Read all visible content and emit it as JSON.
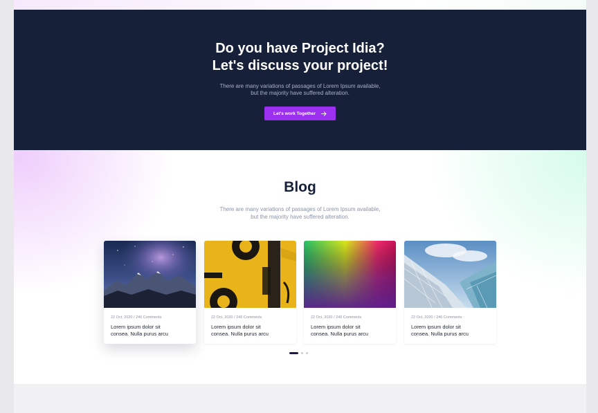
{
  "cta": {
    "title_line1": "Do you have Project Idia?",
    "title_line2": "Let's discuss your project!",
    "subtitle_line1": "There are many variations of passages of Lorem Ipsum available,",
    "subtitle_line2": "but the majority have suffered alteration.",
    "button_label": "Let's work Together",
    "button_icon": "arrow-right-icon",
    "background_color": "#162039",
    "button_color": "#9b30f1"
  },
  "blog": {
    "title": "Blog",
    "subtitle_line1": "There are many variations of passages of Lorem Ipsum available,",
    "subtitle_line2": "but the majority have suffered alteration.",
    "cards": [
      {
        "image": "mountains-starry-sky-image",
        "meta": "22 Oct, 2020 / 246 Comments",
        "title_line1": "Lorem ipsum dolor sit",
        "title_line2": "consea. Nulla purus arcu"
      },
      {
        "image": "yellow-abstract-paint-image",
        "meta": "22 Oct, 2020 / 246 Comments",
        "title_line1": "Lorem ipsum dolor sit",
        "title_line2": "consea. Nulla purus arcu"
      },
      {
        "image": "color-gradient-image",
        "meta": "22 Oct, 2020 / 246 Comments",
        "title_line1": "Lorem ipsum dolor sit",
        "title_line2": "consea. Nulla purus arcu"
      },
      {
        "image": "glass-building-image",
        "meta": "22 Oct, 2020 / 246 Comments",
        "title_line1": "Lorem ipsum dolor sit",
        "title_line2": "consea. Nulla purus arcu"
      }
    ],
    "slider": {
      "total_pages": 3,
      "active_page": 1
    }
  }
}
